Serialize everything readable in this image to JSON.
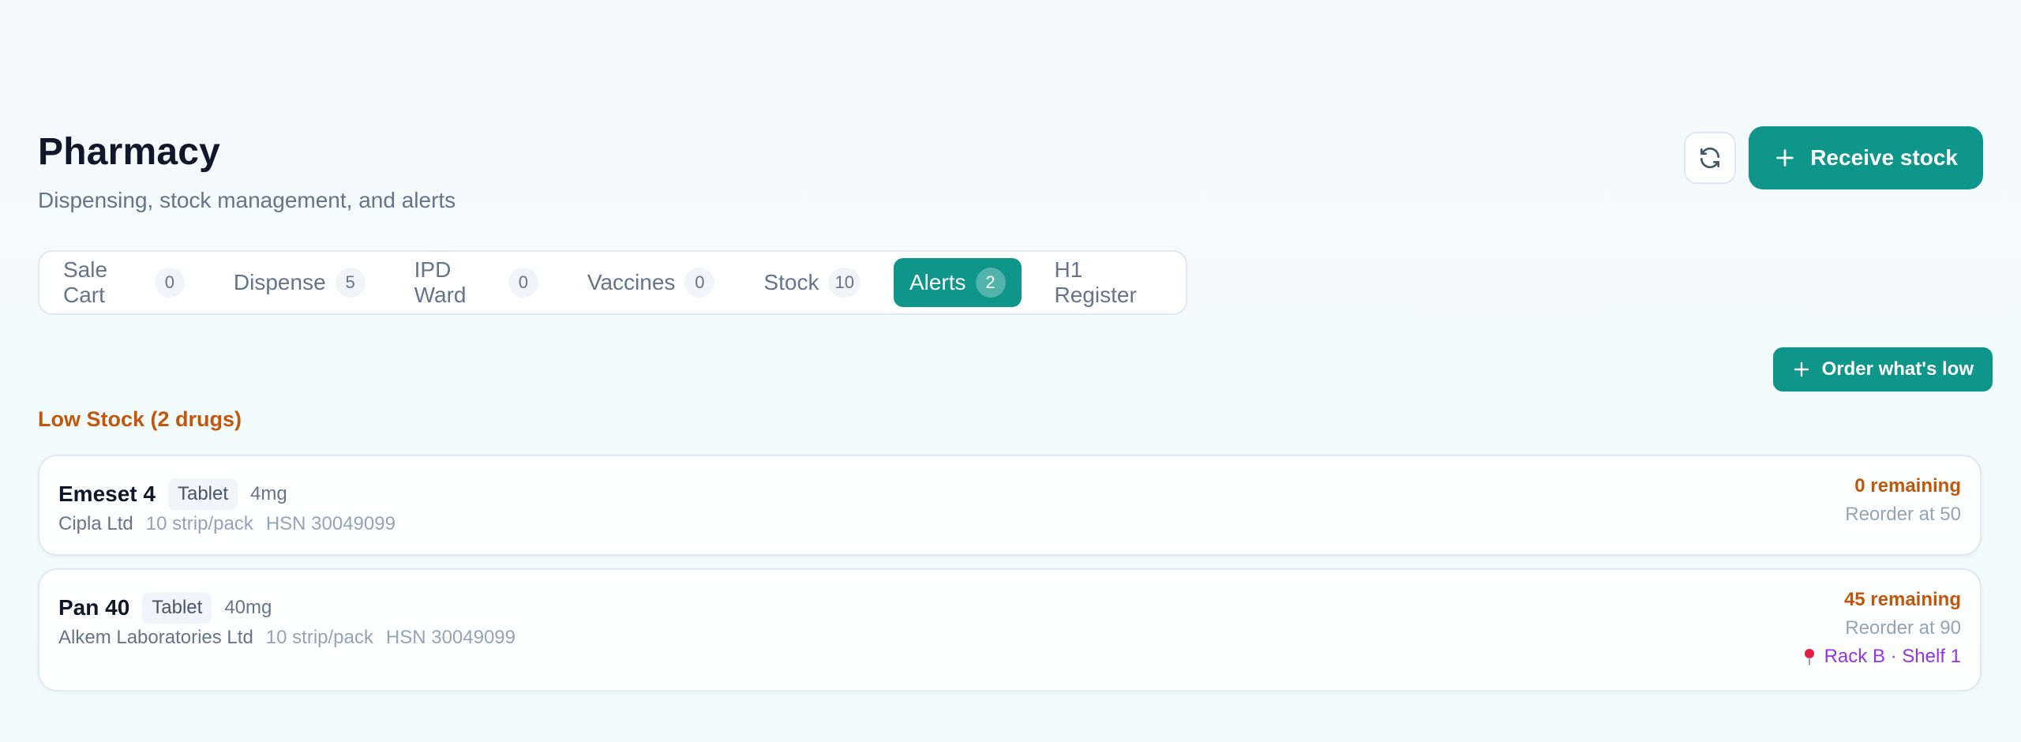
{
  "header": {
    "title": "Pharmacy",
    "subtitle": "Dispensing, stock management, and alerts"
  },
  "actions": {
    "refresh_icon": "refresh-icon",
    "receive_label": "Receive stock"
  },
  "tabs": [
    {
      "label": "Sale Cart",
      "count": "0",
      "active": false
    },
    {
      "label": "Dispense",
      "count": "5",
      "active": false
    },
    {
      "label": "IPD Ward",
      "count": "0",
      "active": false
    },
    {
      "label": "Vaccines",
      "count": "0",
      "active": false
    },
    {
      "label": "Stock",
      "count": "10",
      "active": false
    },
    {
      "label": "Alerts",
      "count": "2",
      "active": true
    },
    {
      "label": "H1 Register",
      "active": false
    }
  ],
  "alerts": {
    "order_button": "Order what's low",
    "section_title": "Low Stock (2 drugs)",
    "items": [
      {
        "name": "Emeset 4",
        "form": "Tablet",
        "strength": "4mg",
        "manufacturer": "Cipla Ltd",
        "pack": "10 strip/pack",
        "hsn": "HSN 30049099",
        "remaining": "0 remaining",
        "reorder": "Reorder at 50"
      },
      {
        "name": "Pan 40",
        "form": "Tablet",
        "strength": "40mg",
        "manufacturer": "Alkem Laboratories Ltd",
        "pack": "10 strip/pack",
        "hsn": "HSN 30049099",
        "remaining": "45 remaining",
        "reorder": "Reorder at 90",
        "location": "Rack B · Shelf 1"
      }
    ]
  },
  "colors": {
    "accent": "#0f968a",
    "warning": "#c2570c",
    "location": "#9333ea",
    "pin": "#e11d48"
  }
}
